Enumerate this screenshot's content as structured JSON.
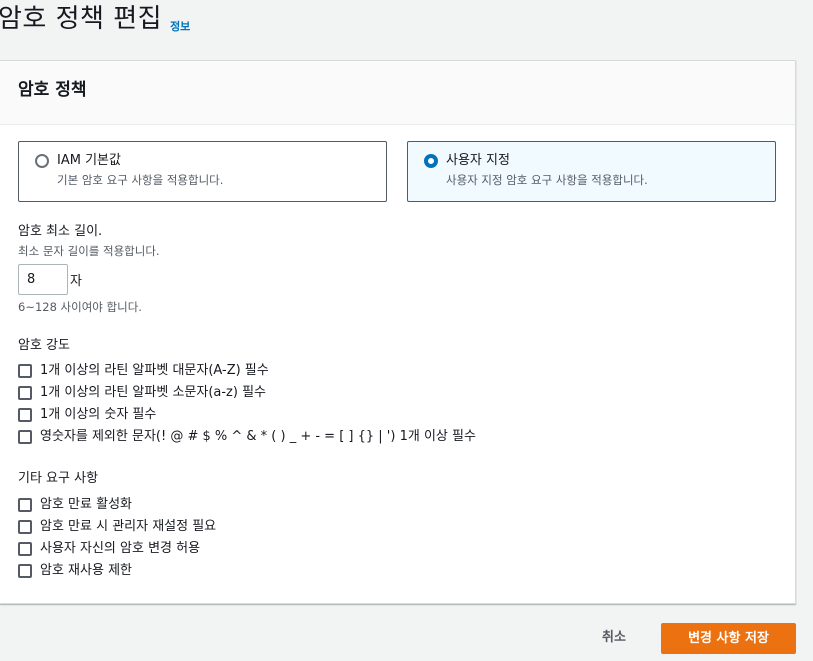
{
  "header": {
    "title": "암호 정책 편집",
    "info_link": "정보"
  },
  "panel": {
    "title": "암호 정책"
  },
  "policy_type": {
    "options": [
      {
        "label": "IAM 기본값",
        "description": "기본 암호 요구 사항을 적용합니다.",
        "selected": false
      },
      {
        "label": "사용자 지정",
        "description": "사용자 지정 암호 요구 사항을 적용합니다.",
        "selected": true
      }
    ]
  },
  "min_length": {
    "label": "암호 최소 길이.",
    "description": "최소 문자 길이를 적용합니다.",
    "value": "8",
    "unit": "자",
    "hint": "6~128 사이여야 합니다."
  },
  "strength": {
    "label": "암호 강도",
    "items": [
      "1개 이상의 라틴 알파벳 대문자(A-Z) 필수",
      "1개 이상의 라틴 알파벳 소문자(a-z) 필수",
      "1개 이상의 숫자 필수",
      "영숫자를 제외한 문자(! @ # $ % ^ & * ( ) _ + - = [ ] {} | ') 1개 이상 필수"
    ]
  },
  "other": {
    "label": "기타 요구 사항",
    "items": [
      "암호 만료 활성화",
      "암호 만료 시 관리자 재설정 필요",
      "사용자 자신의 암호 변경 허용",
      "암호 재사용 제한"
    ]
  },
  "footer": {
    "cancel_label": "취소",
    "save_label": "변경 사항 저장"
  },
  "colors": {
    "accent": "#0073bb",
    "primary_button": "#ec7211",
    "background": "#f2f3f3"
  }
}
